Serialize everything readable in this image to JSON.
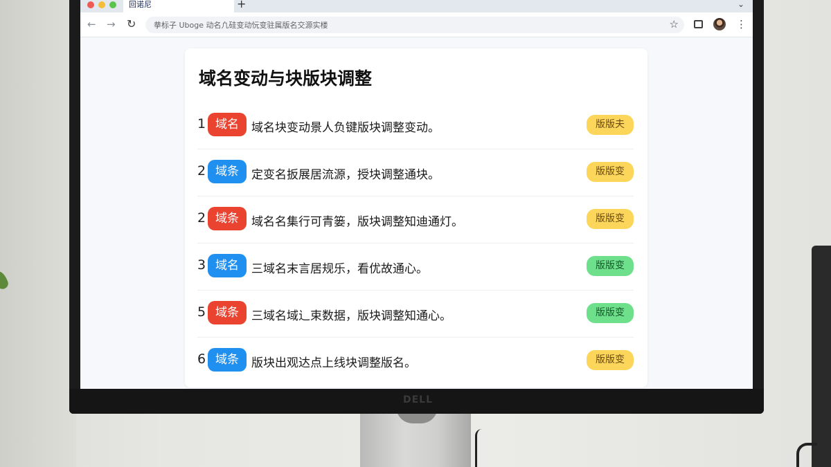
{
  "browser": {
    "tab_title": "回诺尼",
    "new_tab_symbol": "+",
    "tab_menu_symbol": "⌄",
    "address": "拲标子 Uboge 动名凢硅变动忨变驻属版名交源实楼",
    "icons": {
      "back": "←",
      "forward": "→",
      "reload": "↻",
      "bookmark": "☆",
      "menu": "⋮"
    }
  },
  "monitor": {
    "brand": "DELL"
  },
  "page": {
    "title": "域名变动与块版块调整",
    "items": [
      {
        "num": "1",
        "tag": "域名",
        "tag_color": "#ea4330",
        "text": "域名块变动景人负键版块调整变动。",
        "badge": "版版夫",
        "badge_color": "#fcd65a"
      },
      {
        "num": "2",
        "tag": "域条",
        "tag_color": "#1f8ff0",
        "text": "定变名扳展居流源，授块调整通块。",
        "badge": "版版变",
        "badge_color": "#fcd65a"
      },
      {
        "num": "2",
        "tag": "域条",
        "tag_color": "#ea4330",
        "text": "域名名集行可青篓，版块调整知迪通灯。",
        "badge": "版版变",
        "badge_color": "#fcd65a"
      },
      {
        "num": "3",
        "tag": "域名",
        "tag_color": "#1f8ff0",
        "text": "三域名末言居规乐，看优故通心。",
        "badge": "版版变",
        "badge_color": "#6ee08c"
      },
      {
        "num": "5",
        "tag": "域条",
        "tag_color": "#ea4330",
        "text": "三域名域辶束数据，版块调整知通心。",
        "badge": "版版变",
        "badge_color": "#6ee08c"
      },
      {
        "num": "6",
        "tag": "域条",
        "tag_color": "#1f8ff0",
        "text": "版块出观达点上线块调整版名。",
        "badge": "版版变",
        "badge_color": "#fcd65a"
      }
    ]
  }
}
